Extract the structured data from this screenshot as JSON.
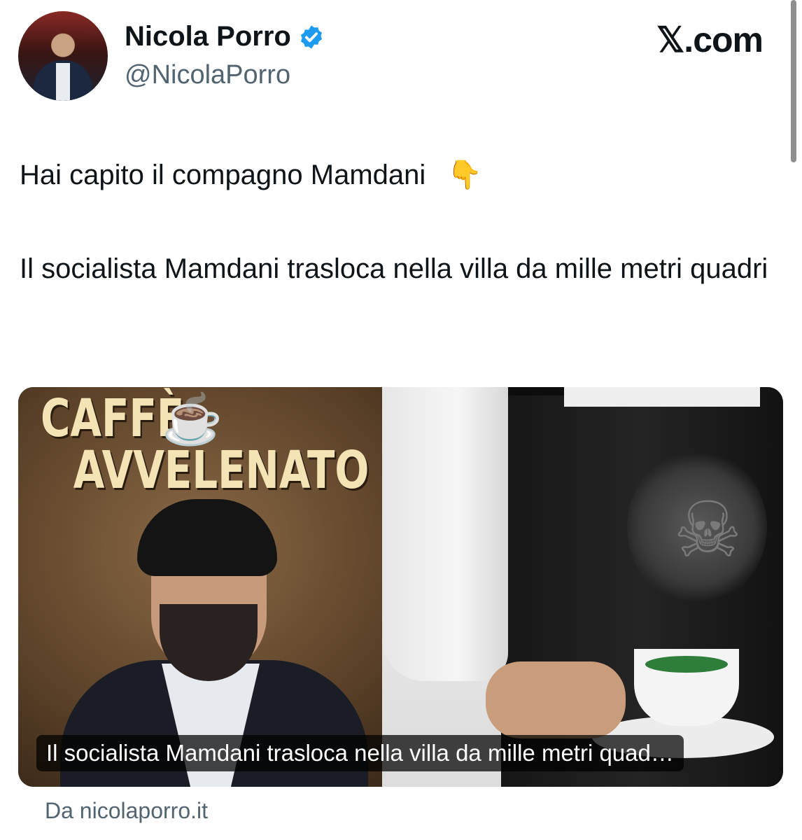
{
  "author": {
    "name": "Nicola Porro",
    "handle": "@NicolaPorro",
    "verified_icon": "verified-badge-icon",
    "verified_color": "#1d9bf0"
  },
  "site_logo": "𝕏.com",
  "tweet": {
    "line1": "Hai capito il compagno Mamdani",
    "line1_emoji": "👇",
    "line2": "Il socialista Mamdani trasloca nella villa da mille metri quadri"
  },
  "card": {
    "image_title_line1": "CAFFÈ",
    "image_title_line2": "AVVELENATO",
    "caption": "Il socialista Mamdani trasloca nella villa da mille metri quad…",
    "source": "Da nicolaporro.it"
  },
  "colors": {
    "text": "#0f1419",
    "secondary_text": "#536471",
    "title_cream": "#f3e3b5"
  }
}
